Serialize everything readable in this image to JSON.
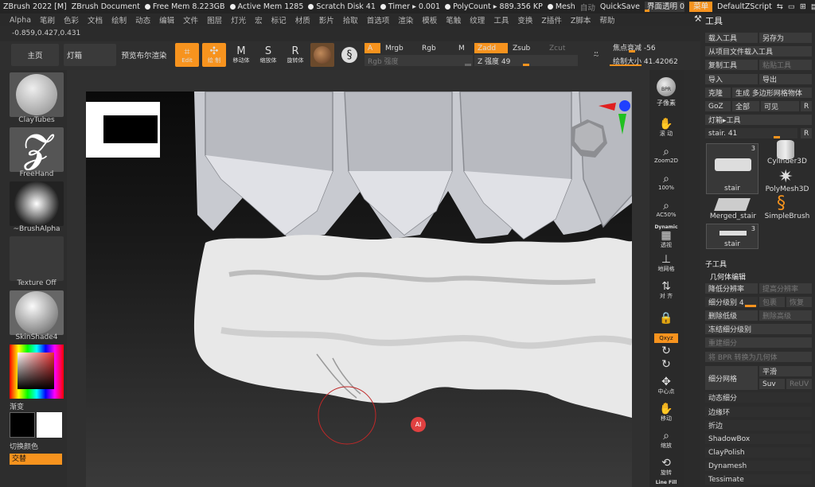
{
  "titlebar": {
    "app": "ZBrush 2022 [M]",
    "doc": "ZBrush Document",
    "free_mem": "Free Mem 8.223GB",
    "active_mem": "Active Mem 1285",
    "scratch": "Scratch Disk 41",
    "timer": "Timer ▸ 0.001",
    "polycount": "PolyCount ▸ 889.356 KP",
    "mesh": "Mesh",
    "auto": "自动",
    "quicksave": "QuickSave",
    "transparency": "界面透明 0",
    "transparency_value": 0,
    "menu_btn": "菜单",
    "script": "DefaultZScript"
  },
  "menubar": [
    "Alpha",
    "笔刷",
    "色彩",
    "文档",
    "绘制",
    "动态",
    "编辑",
    "文件",
    "图层",
    "灯光",
    "宏",
    "标记",
    "材质",
    "影片",
    "拾取",
    "首选项",
    "渲染",
    "模板",
    "笔触",
    "纹理",
    "工具",
    "变换",
    "Z插件",
    "Z脚本",
    "帮助"
  ],
  "coords": "-0.859,0.427,0.431",
  "shelf": {
    "home": "主页",
    "lightbox": "灯箱",
    "bpr": "预览布尔渲染",
    "edit": "Edit",
    "draw": "绘 制",
    "move": "移动体",
    "scale": "缩放体",
    "rotate": "旋转体",
    "a": "A",
    "mrgb": "Mrgb",
    "rgb": "Rgb",
    "m": "M",
    "rgb_intensity": "Rgb 强度",
    "zadd": "Zadd",
    "zsub": "Zsub",
    "zcut": "Zcut",
    "z_intensity": "Z 强度 49",
    "z_intensity_value": 49,
    "focal_shift": "焦点衰减 -56",
    "focal_shift_value": -56,
    "draw_size": "绘制大小 41.42062",
    "draw_size_value": 41.42062
  },
  "left": {
    "brush": "ClayTubes",
    "stroke": "FreeHand",
    "alpha": "~BrushAlpha",
    "texture": "Texture Off",
    "material": "SkinShade4",
    "gradient": "渐变",
    "switch_color": "切换颜色",
    "swap": "交替"
  },
  "rightstrip": {
    "bpr": "BPR",
    "subpixel": "子像素",
    "scroll": "滚 动",
    "zoom2d": "Zoom2D",
    "p100": "100%",
    "ac50": "AC50%",
    "dynamic": "Dynamic",
    "persp": "透视",
    "floor": "地网格",
    "local": "对 齐",
    "xyz": "Qxyz",
    "center": "中心点",
    "move": "移动",
    "zoom": "缩放",
    "rotate": "旋转",
    "linefill": "Line Fill"
  },
  "panel": {
    "title": "工具",
    "load": "载入工具",
    "save": "另存为",
    "load_project": "从项目文件载入工具",
    "copy": "复制工具",
    "paste": "粘贴工具",
    "import": "导入",
    "export": "导出",
    "clone": "克隆",
    "make_polymesh": "生成 多边形网格物体",
    "goz": "GoZ",
    "all": "全部",
    "visible": "可见",
    "r": "R",
    "lightbox_tools": "灯箱▸工具",
    "tool_slider": "stair. 41",
    "tool_slider_value": 41,
    "thumbs": [
      {
        "label": "stair",
        "count": "3"
      },
      {
        "label": "Cylinder3D"
      },
      {
        "label": "PolyMesh3D"
      },
      {
        "label": "Merged_stair"
      },
      {
        "label": "SimpleBrush"
      },
      {
        "label": "stair",
        "count": "3"
      }
    ],
    "subtool": "子工具",
    "geometry": "几何体编辑",
    "lower_res": "降低分辨率",
    "higher_res": "提高分辨率",
    "sdiv": "细分级别 4",
    "sdiv_value": 4,
    "cage": "包裹",
    "restore": "恢复",
    "del_lower": "删除低级",
    "del_higher": "删除高级",
    "freeze": "冻结细分级别",
    "reconstruct": "重建细分",
    "bpr_to_geo": "将 BPR 转换为几何体",
    "divide": "细分网格",
    "smooth": "平滑",
    "suv": "Suv",
    "reuv": "ReUV",
    "dynamic_sub": "动态细分",
    "edgeloop": "边缘环",
    "crease": "折边",
    "shadowbox": "ShadowBox",
    "claypolish": "ClayPolish",
    "dynamesh": "Dynamesh",
    "tessimate": "Tessimate"
  },
  "colors": {
    "accent": "#f7931e",
    "bg": "#2b2b2b"
  }
}
